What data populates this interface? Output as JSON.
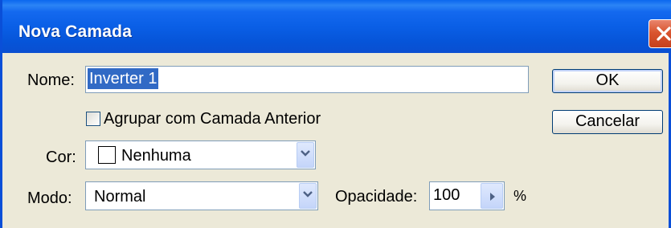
{
  "window": {
    "title": "Nova Camada"
  },
  "form": {
    "name_label": "Nome:",
    "name_value": "Inverter 1",
    "group_label": "Agrupar com Camada Anterior",
    "color_label": "Cor:",
    "color_value": "Nenhuma",
    "mode_label": "Modo:",
    "mode_value": "Normal",
    "opacity_label": "Opacidade:",
    "opacity_value": "100",
    "opacity_unit": "%"
  },
  "buttons": {
    "ok": "OK",
    "cancel": "Cancelar"
  },
  "colors": {
    "titlebar": "#0a5fe6",
    "dialog_bg": "#ece9d8",
    "selection": "#316ac5",
    "close": "#d9552f"
  }
}
